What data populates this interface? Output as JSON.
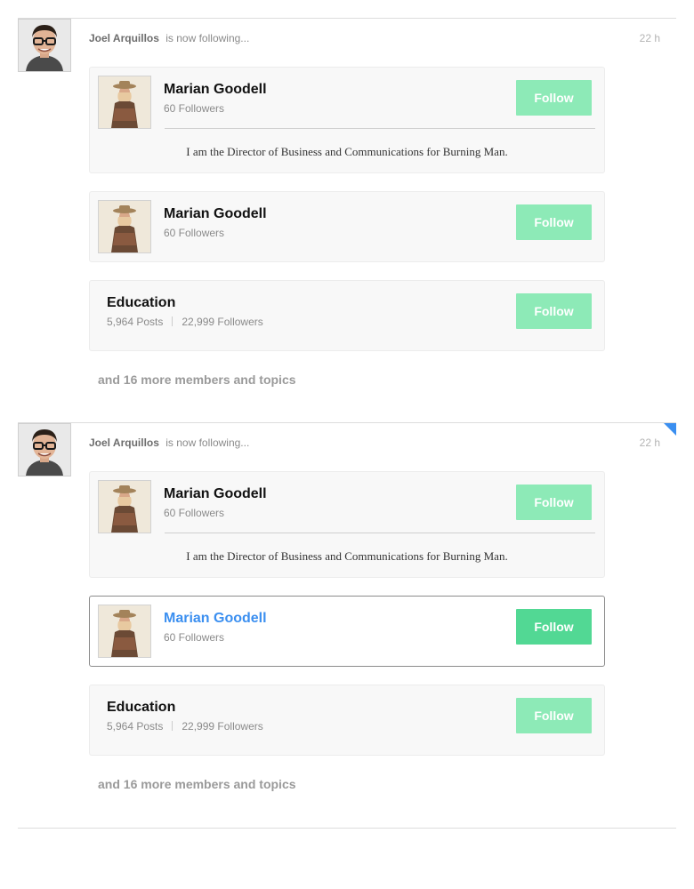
{
  "stories": [
    {
      "actor": "Joel Arquillos",
      "action": "is now following...",
      "time": "22 h",
      "cards": {
        "bio": {
          "name": "Marian Goodell",
          "followers": "60 Followers",
          "bio": "I am the Director of Business and Communications for Burning Man.",
          "follow_label": "Follow"
        },
        "user": {
          "name": "Marian Goodell",
          "followers": "60 Followers",
          "follow_label": "Follow"
        },
        "topic": {
          "name": "Education",
          "posts": "5,964 Posts",
          "followers": "22,999 Followers",
          "follow_label": "Follow"
        }
      },
      "more": "and 16 more members and topics"
    },
    {
      "actor": "Joel Arquillos",
      "action": "is now following...",
      "time": "22 h",
      "cards": {
        "bio": {
          "name": "Marian Goodell",
          "followers": "60 Followers",
          "bio": "I am the Director of Business and Communications for Burning Man.",
          "follow_label": "Follow"
        },
        "user": {
          "name": "Marian Goodell",
          "followers": "60 Followers",
          "follow_label": "Follow"
        },
        "topic": {
          "name": "Education",
          "posts": "5,964 Posts",
          "followers": "22,999 Followers",
          "follow_label": "Follow"
        }
      },
      "more": "and 16 more members and topics"
    }
  ],
  "colors": {
    "follow_button": "#8deab7",
    "follow_button_hover": "#52d894",
    "link_active": "#3b8ff0",
    "corner_flag": "#3b8ff0"
  },
  "icons": {
    "actor_avatar": "person-photo-icon",
    "member_thumb": "person-photo-icon"
  }
}
